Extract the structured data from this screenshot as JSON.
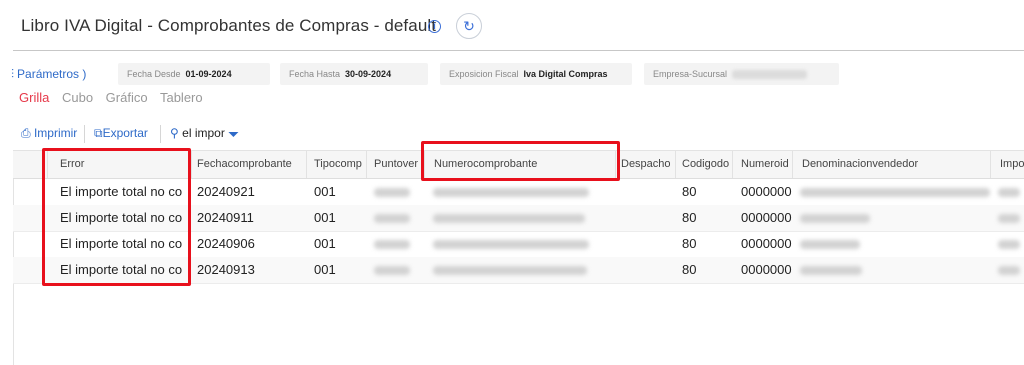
{
  "header": {
    "title": "Libro IVA Digital - Comprobantes de Compras - default",
    "info_icon": "i",
    "refresh_icon": "↻"
  },
  "params": {
    "link_label": "Parámetros )",
    "filters": [
      {
        "label": "Fecha Desde",
        "value": "01-09-2024"
      },
      {
        "label": "Fecha Hasta",
        "value": "30-09-2024"
      },
      {
        "label": "Exposicion Fiscal",
        "value": "Iva Digital Compras"
      },
      {
        "label": "Empresa-Sucursal",
        "value": ""
      }
    ]
  },
  "views": [
    "Grilla",
    "Cubo",
    "Gráfico",
    "Tablero"
  ],
  "active_view": "Grilla",
  "toolbar": {
    "print_label": "Imprimir",
    "export_label": "Exportar",
    "search_value": "el impor"
  },
  "grid": {
    "columns": [
      "Error",
      "Fechacomprobante",
      "Tipocomp",
      "Puntover",
      "Numerocomprobante",
      "Despacho",
      "Codigodo",
      "Numeroid",
      "Denominacionvendedor",
      "Impo"
    ],
    "rows": [
      {
        "error": "El importe total no co",
        "fecha": "20240921",
        "tipo": "001",
        "codigo": "80",
        "numeroid": "0000000"
      },
      {
        "error": "El importe total no co",
        "fecha": "20240911",
        "tipo": "001",
        "codigo": "80",
        "numeroid": "0000000"
      },
      {
        "error": "El importe total no co",
        "fecha": "20240906",
        "tipo": "001",
        "codigo": "80",
        "numeroid": "0000000"
      },
      {
        "error": "El importe total no co",
        "fecha": "20240913",
        "tipo": "001",
        "codigo": "80",
        "numeroid": "0000000"
      }
    ]
  },
  "colors": {
    "accent": "#2e6ac8",
    "active_tab": "#e6394a",
    "highlight": "#e8101c"
  }
}
